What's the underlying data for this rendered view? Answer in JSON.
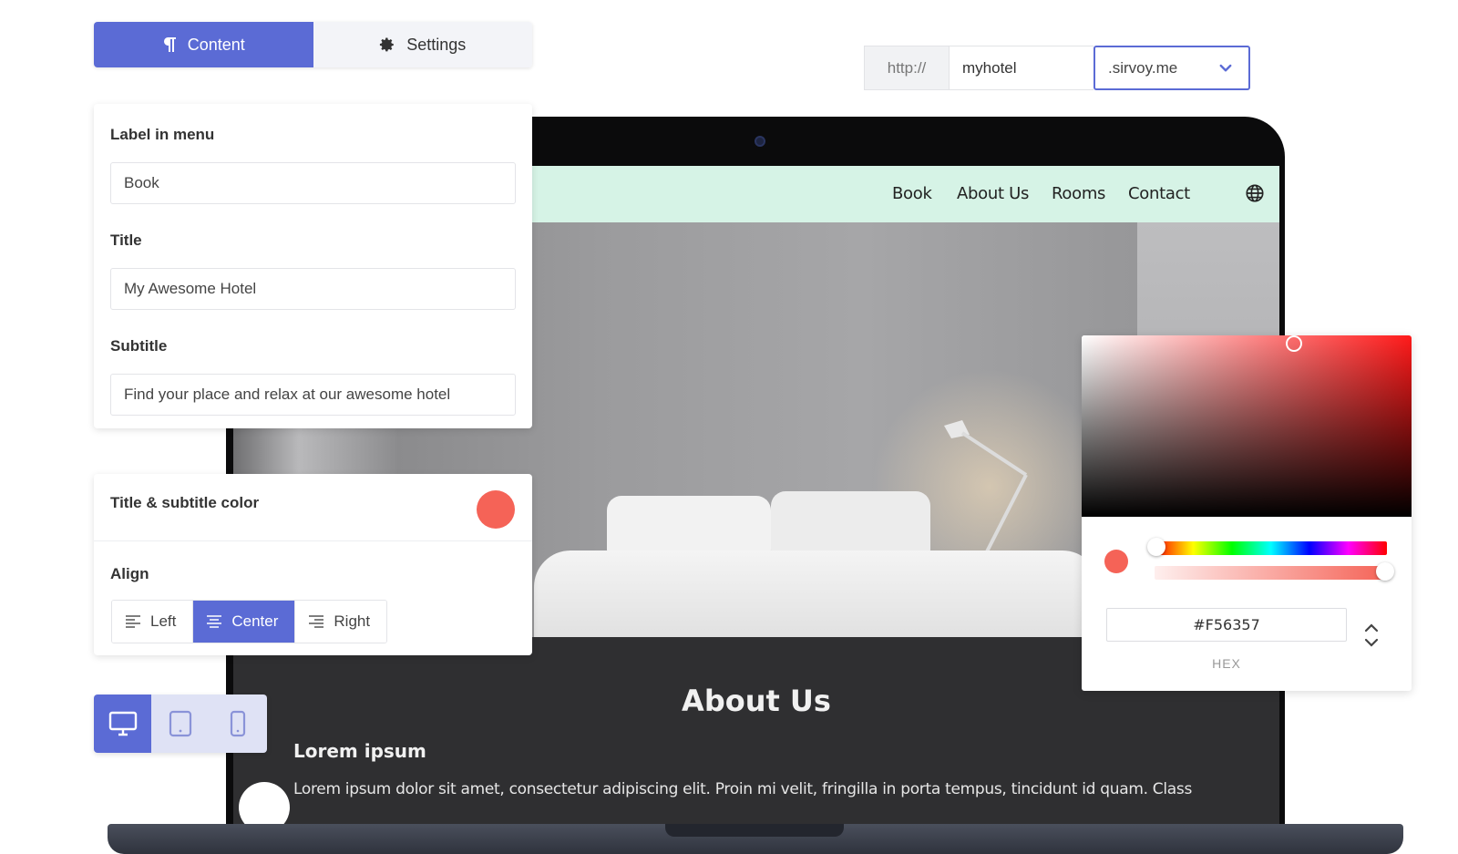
{
  "tabs": [
    {
      "label": "Content",
      "icon": "paragraph-icon",
      "active": true
    },
    {
      "label": "Settings",
      "icon": "gear-icon",
      "active": false
    }
  ],
  "url": {
    "prefix": "http://",
    "subdomain": "myhotel",
    "domain": ".sirvoy.me"
  },
  "content_form": {
    "label_in_menu": {
      "label": "Label in menu",
      "value": "Book"
    },
    "title": {
      "label": "Title",
      "value": "My Awesome Hotel"
    },
    "subtitle": {
      "label": "Subtitle",
      "value": "Find your place and relax at our awesome hotel"
    }
  },
  "style_form": {
    "color_label": "Title & subtitle color",
    "color_value": "#F56357",
    "align_label": "Align",
    "align_options": [
      {
        "label": "Left",
        "active": false
      },
      {
        "label": "Center",
        "active": true
      },
      {
        "label": "Right",
        "active": false
      }
    ]
  },
  "devices": [
    {
      "icon": "desktop-icon",
      "active": true
    },
    {
      "icon": "tablet-icon",
      "active": false
    },
    {
      "icon": "mobile-icon",
      "active": false
    }
  ],
  "site_preview": {
    "nav": [
      "Book",
      "About Us",
      "Rooms",
      "Contact"
    ],
    "about_title": "About Us",
    "lorem_head": "Lorem ipsum",
    "lorem_text": "Lorem ipsum dolor sit amet, consectetur adipiscing elit. Proin mi velit, fringilla in porta tempus, tincidunt id quam. Class"
  },
  "color_picker": {
    "hex": "#F56357",
    "format_label": "HEX"
  },
  "colors": {
    "accent": "#5b6bd5",
    "nav_bg": "#d6f3e6",
    "picked": "#f56357"
  }
}
